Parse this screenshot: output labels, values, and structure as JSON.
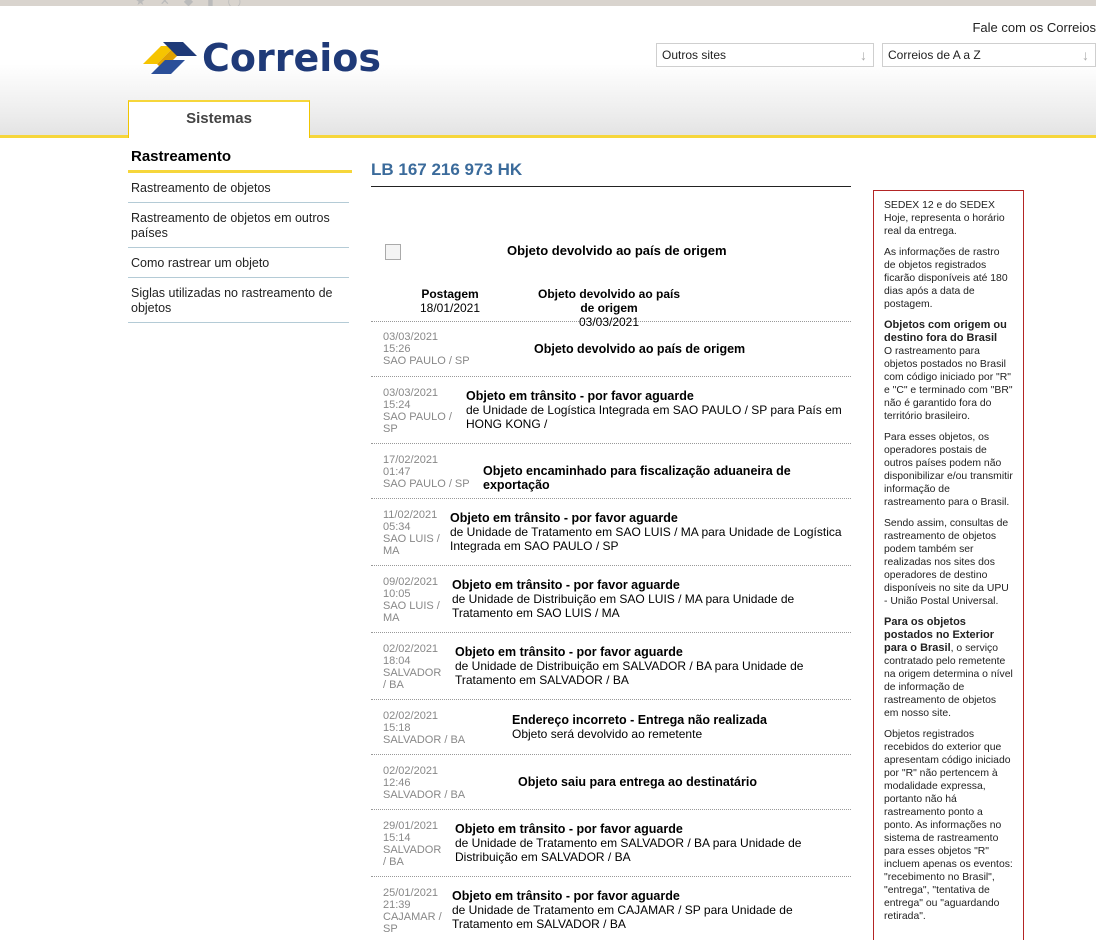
{
  "header": {
    "logo_text": "Correios",
    "fale": "Fale com os Correios",
    "select_outros": "Outros sites",
    "select_az": "Correios de A a Z",
    "tab_sistemas": "Sistemas",
    "brand_blue": "#1f3a78",
    "brand_yellow": "#f6d63b"
  },
  "sidebar": {
    "title": "Rastreamento",
    "items": [
      {
        "label": "Rastreamento de objetos"
      },
      {
        "label": "Rastreamento de objetos em outros países"
      },
      {
        "label": "Como rastrear um objeto"
      },
      {
        "label": "Siglas utilizadas no rastreamento de objetos"
      }
    ]
  },
  "tracking": {
    "code": "LB 167 216 973 HK",
    "summary_title": "Objeto devolvido ao país de origem",
    "posting_label": "Postagem",
    "posting_date": "18/01/2021",
    "status_label": "Objeto devolvido ao país de origem",
    "status_date": "03/03/2021",
    "events": [
      {
        "date": "03/03/2021",
        "time": "15:26",
        "place": "SAO PAULO / SP",
        "title": "Objeto devolvido ao país de origem",
        "detail": ""
      },
      {
        "date": "03/03/2021",
        "time": "15:24",
        "place": "SAO PAULO / SP",
        "title": "Objeto em trânsito - por favor aguarde",
        "detail": "de Unidade de Logística Integrada em SAO PAULO / SP para País em HONG KONG /"
      },
      {
        "date": "17/02/2021",
        "time": "01:47",
        "place": "SAO PAULO / SP",
        "title": "Objeto encaminhado para fiscalização aduaneira de exportação",
        "detail": ""
      },
      {
        "date": "11/02/2021",
        "time": "05:34",
        "place": "SAO LUIS / MA",
        "title": "Objeto em trânsito - por favor aguarde",
        "detail": "de Unidade de Tratamento em SAO LUIS / MA para Unidade de Logística Integrada em SAO PAULO / SP"
      },
      {
        "date": "09/02/2021",
        "time": "10:05",
        "place": "SAO LUIS / MA",
        "title": "Objeto em trânsito - por favor aguarde",
        "detail": "de Unidade de Distribuição em SAO LUIS / MA para Unidade de Tratamento em SAO LUIS / MA"
      },
      {
        "date": "02/02/2021",
        "time": "18:04",
        "place": "SALVADOR / BA",
        "title": "Objeto em trânsito - por favor aguarde",
        "detail": "de Unidade de Distribuição em SALVADOR / BA para Unidade de Tratamento em SALVADOR / BA"
      },
      {
        "date": "02/02/2021",
        "time": "15:18",
        "place": "SALVADOR / BA",
        "title": "Endereço incorreto - Entrega não realizada",
        "detail": "Objeto será devolvido ao remetente"
      },
      {
        "date": "02/02/2021",
        "time": "12:46",
        "place": "SALVADOR / BA",
        "title": "Objeto saiu para entrega ao destinatário",
        "detail": ""
      },
      {
        "date": "29/01/2021",
        "time": "15:14",
        "place": "SALVADOR / BA",
        "title": "Objeto em trânsito - por favor aguarde",
        "detail": "de Unidade de Tratamento em SALVADOR / BA para Unidade de Distribuição em SALVADOR / BA"
      },
      {
        "date": "25/01/2021",
        "time": "21:39",
        "place": "CAJAMAR / SP",
        "title": "Objeto em trânsito - por favor aguarde",
        "detail": "de Unidade de Tratamento em CAJAMAR / SP para Unidade de Tratamento em SALVADOR / BA"
      }
    ]
  },
  "info": {
    "p1": "SEDEX 12 e do SEDEX Hoje, representa o horário real da entrega.",
    "p2": "As informações de rastro de objetos registrados ficarão disponíveis até 180 dias após a data de postagem.",
    "h1": "Objetos com origem ou destino fora do Brasil",
    "p3": "O rastreamento para objetos postados no Brasil com código iniciado por \"R\" e \"C\" e terminado com \"BR\" não é garantido fora do território brasileiro.",
    "p4": "Para esses objetos, os operadores postais de outros países podem não disponibilizar e/ou transmitir informação de rastreamento para o Brasil.",
    "p5": "Sendo assim, consultas de rastreamento de objetos podem também ser realizadas nos sites dos operadores de destino disponíveis no site da UPU - União Postal Universal.",
    "h2": "Para os objetos postados no Exterior para o Brasil",
    "p6": ", o serviço contratado pelo remetente na origem determina o nível de informação de rastreamento de objetos em nosso site.",
    "p7": "Objetos registrados recebidos do exterior que apresentam código iniciado por \"R\" não pertencem à modalidade expressa, portanto não há rastreamento ponto a ponto. As informações no sistema de rastreamento para esses objetos \"R\" incluem apenas os eventos: \"recebimento no Brasil\", \"entrega\", \"tentativa de entrega\" ou \"aguardando retirada\"."
  }
}
